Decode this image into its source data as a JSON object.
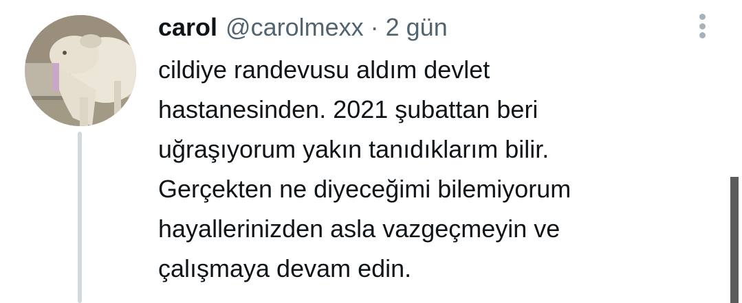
{
  "tweet": {
    "author": {
      "display_name": "carol",
      "handle": "@carolmexx",
      "separator": "·",
      "time": "2 gün",
      "avatar_icon": "goat-avatar"
    },
    "more_icon": "more-options-icon",
    "text_lines": [
      "cildiye randevusu aldım devlet",
      "hastanesinden. 2021 şubattan beri",
      "uğraşıyorum yakın tanıdıklarım bilir.",
      "Gerçekten ne diyeceğimi bilemiyorum",
      "hayallerinizden asla vazgeçmeyin ve",
      "çalışmaya devam edin."
    ]
  },
  "colors": {
    "name": "#0f1419",
    "meta": "#536471",
    "thread_line": "#cfd9de",
    "dots": "#a7b1ba",
    "scrollbar": "#5c5c5c"
  }
}
